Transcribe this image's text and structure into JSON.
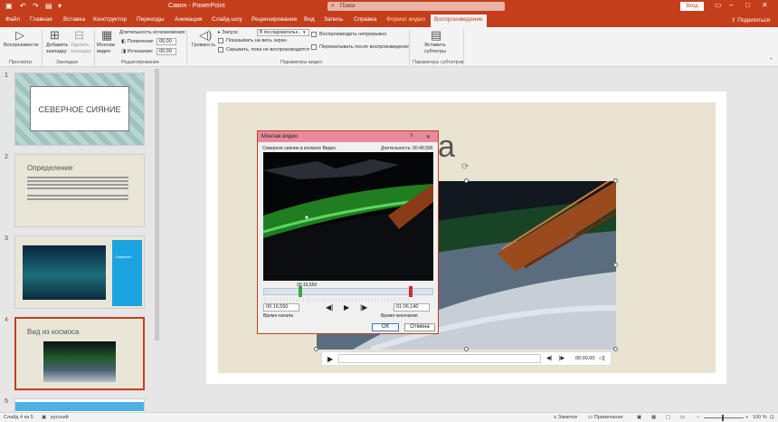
{
  "titlebar": {
    "doc_title": "Савон - PowerPoint",
    "search_placeholder": "Поиск",
    "signin": "Вход"
  },
  "tabs": [
    "Файл",
    "Главная",
    "Вставка",
    "Конструктор",
    "Переходы",
    "Анимация",
    "Слайд-шоу",
    "Рецензирование",
    "Вид",
    "Запись",
    "Справка",
    "Формат видео",
    "Воспроизведение"
  ],
  "share_label": "Поделиться",
  "ribbon": {
    "preview_label": "Воспроизвести",
    "add_bookmark": "Добавить закладку",
    "remove_bookmark": "Удалить закладку",
    "trim_video": "Монтаж видео",
    "fade_duration": "Длительность исчезновения",
    "fade_in": "Появление:",
    "fade_in_value": "00,00",
    "fade_out": "Исчезание:",
    "fade_out_value": "00,00",
    "volume": "Громкость",
    "start": "Запуск:",
    "start_value": "В последовательн...",
    "fullscreen": "Показывать на весь экран",
    "hide": "Скрывать, пока не воспроизводится",
    "loop": "Воспроизводить непрерывно",
    "rewind": "Перематывать после воспроизведения",
    "insert_captions": "Вставить субтитры",
    "groups": {
      "preview": "Просмотр",
      "bookmarks": "Закладки",
      "editing": "Редактирование",
      "video_options": "Параметры видео",
      "captions": "Параметры субтитров"
    }
  },
  "slides": [
    {
      "num": "1",
      "title": "СЕВЕРНОЕ СИЯНИЕ"
    },
    {
      "num": "2",
      "title": "Определение"
    },
    {
      "num": "3",
      "title": "Северное"
    },
    {
      "num": "4",
      "title": "Вид из космоса"
    },
    {
      "num": "5",
      "title": ""
    }
  ],
  "slide": {
    "title_fragment": "са"
  },
  "video_player": {
    "time": "00:00,00"
  },
  "dialog": {
    "title": "Монтаж видео",
    "help": "?",
    "close": "✕",
    "file_name": "Северное сияние в космосе Видео",
    "duration": "Длительность: 00:49,590",
    "marker_time": "00:16,550",
    "start_value": "00:16,550",
    "start_label": "Время начала",
    "end_value": "01:06,140",
    "end_label": "Время окончания",
    "ok": "ОК",
    "cancel": "Отмена",
    "start_marker_fraction": 0.215,
    "end_marker_fraction": 0.87
  },
  "status": {
    "slide_counter": "Слайд 4 из 5",
    "language": "русский",
    "notes": "Заметки",
    "comments": "Примечания",
    "zoom": "100 %"
  },
  "colors": {
    "accent": "#c43e1c",
    "dialog_title": "#e88a9e",
    "start_marker": "#3aa63a",
    "end_marker": "#d12a2a"
  }
}
